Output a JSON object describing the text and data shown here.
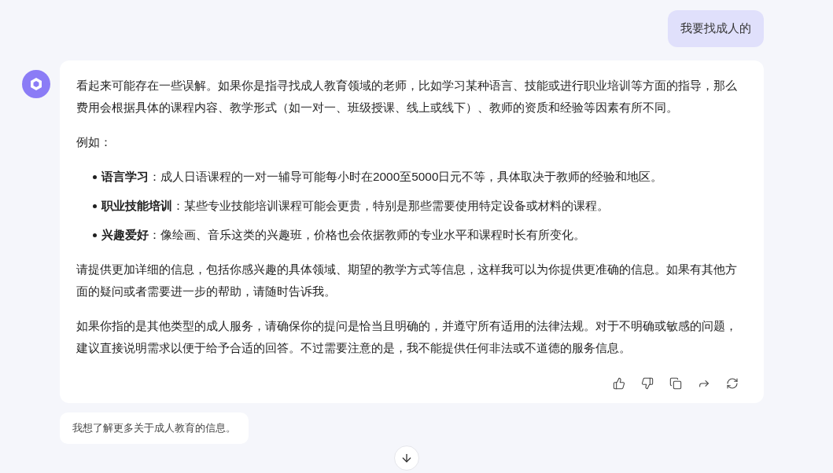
{
  "user_message": {
    "text": "我要找成人的"
  },
  "assistant_message": {
    "blocks": [
      {
        "kind": "paragraph",
        "text": "看起来可能存在一些误解。如果你是指寻找成人教育领域的老师，比如学习某种语言、技能或进行职业培训等方面的指导，那么费用会根据具体的课程内容、教学形式（如一对一、班级授课、线上或线下）、教师的资质和经验等因素有所不同。"
      },
      {
        "kind": "paragraph",
        "text": "例如："
      },
      {
        "kind": "list",
        "items": [
          "**语言学习**：成人日语课程的一对一辅导可能每小时在2000至5000日元不等，具体取决于教师的经验和地区。",
          "**职业技能培训**：某些专业技能培训课程可能会更贵，特别是那些需要使用特定设备或材料的课程。",
          "**兴趣爱好**：像绘画、音乐这类的兴趣班，价格也会依据教师的专业水平和课程时长有所变化。"
        ]
      },
      {
        "kind": "paragraph",
        "text": "请提供更加详细的信息，包括你感兴趣的具体领域、期望的教学方式等信息，这样我可以为你提供更准确的信息。如果有其他方面的疑问或者需要进一步的帮助，请随时告诉我。"
      },
      {
        "kind": "paragraph",
        "text": "如果你指的是其他类型的成人服务，请确保你的提问是恰当且明确的，并遵守所有适用的法律法规。对于不明确或敏感的问题，建议直接说明需求以便于给予合适的回答。不过需要注意的是，我不能提供任何非法或不道德的服务信息。"
      }
    ]
  },
  "suggestion": {
    "text": "我想了解更多关于成人教育的信息。"
  }
}
